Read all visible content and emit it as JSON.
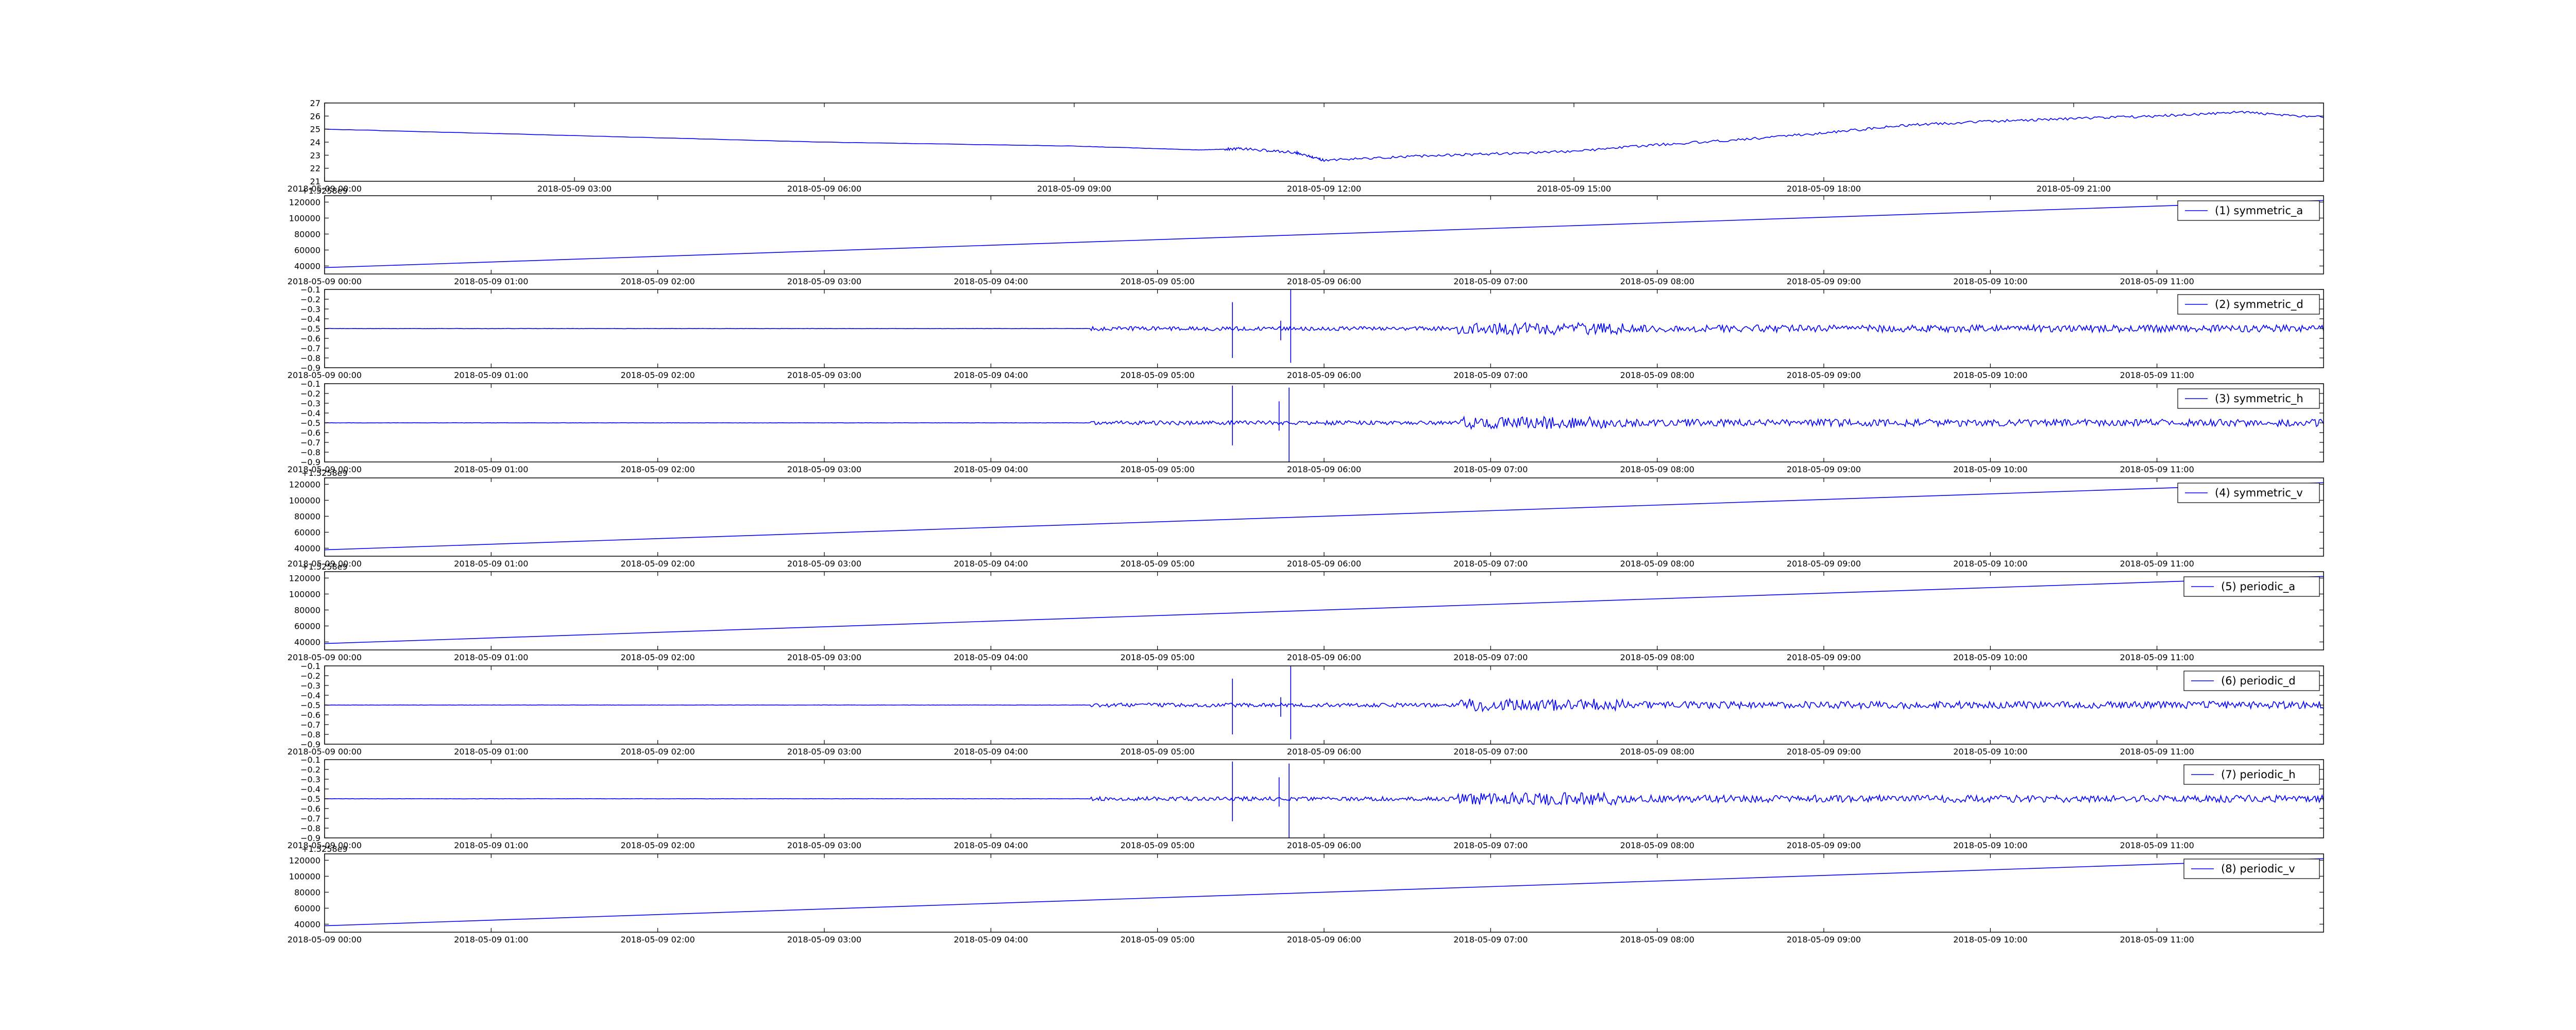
{
  "figure": {
    "background": "#ffffff",
    "line_color": "#0000ff"
  },
  "chart_data": [
    {
      "type": "line",
      "series": [
        {
          "name": "",
          "x": [
            "2018-05-09 00:00",
            "2018-05-09 03:00",
            "2018-05-09 06:00",
            "2018-05-09 09:00",
            "2018-05-09 10:30",
            "2018-05-09 11:00",
            "2018-05-09 11:40",
            "2018-05-09 12:00",
            "2018-05-09 13:00",
            "2018-05-09 14:00",
            "2018-05-09 15:00",
            "2018-05-09 16:00",
            "2018-05-09 17:00",
            "2018-05-09 18:00",
            "2018-05-09 19:00",
            "2018-05-09 20:00",
            "2018-05-09 21:00",
            "2018-05-09 22:00",
            "2018-05-09 23:00",
            "2018-05-09 23:59"
          ],
          "values": [
            25.0,
            24.5,
            24.0,
            23.7,
            23.4,
            23.5,
            23.2,
            22.6,
            22.9,
            23.1,
            23.3,
            23.8,
            24.2,
            24.7,
            25.3,
            25.6,
            25.8,
            26.0,
            26.3,
            25.9
          ]
        }
      ],
      "xticks": [
        "2018-05-09 00:00",
        "2018-05-09 03:00",
        "2018-05-09 06:00",
        "2018-05-09 09:00",
        "2018-05-09 12:00",
        "2018-05-09 15:00",
        "2018-05-09 18:00",
        "2018-05-09 21:00"
      ],
      "yticks": [
        "21",
        "22",
        "23",
        "24",
        "25",
        "26",
        "27"
      ],
      "ylim": [
        21,
        27
      ],
      "offset_text": "",
      "legend": null
    },
    {
      "type": "line",
      "series": [
        {
          "name": "(1) symmetric_a",
          "x": [
            0,
            12
          ],
          "values": [
            38000,
            122000
          ]
        }
      ],
      "xticks": [
        "2018-05-09 00:00",
        "2018-05-09 01:00",
        "2018-05-09 02:00",
        "2018-05-09 03:00",
        "2018-05-09 04:00",
        "2018-05-09 05:00",
        "2018-05-09 06:00",
        "2018-05-09 07:00",
        "2018-05-09 08:00",
        "2018-05-09 09:00",
        "2018-05-09 10:00",
        "2018-05-09 11:00"
      ],
      "yticks": [
        "40000",
        "60000",
        "80000",
        "100000",
        "120000"
      ],
      "ylim": [
        30000,
        128000
      ],
      "offset_text": "+1.5258e9",
      "legend": {
        "label": "(1) symmetric_a",
        "loc": "upper right"
      }
    },
    {
      "type": "line",
      "series": [
        {
          "name": "(2) symmetric_d",
          "baseline": -0.5
        }
      ],
      "xticks": [
        "2018-05-09 00:00",
        "2018-05-09 01:00",
        "2018-05-09 02:00",
        "2018-05-09 03:00",
        "2018-05-09 04:00",
        "2018-05-09 05:00",
        "2018-05-09 06:00",
        "2018-05-09 07:00",
        "2018-05-09 08:00",
        "2018-05-09 09:00",
        "2018-05-09 10:00",
        "2018-05-09 11:00"
      ],
      "yticks": [
        "−0.9",
        "−0.8",
        "−0.7",
        "−0.6",
        "−0.5",
        "−0.4",
        "−0.3",
        "−0.2",
        "−0.1"
      ],
      "ylim": [
        -0.9,
        -0.1
      ],
      "offset_text": "",
      "legend": {
        "label": "(2) symmetric_d",
        "loc": "upper right"
      }
    },
    {
      "type": "line",
      "series": [
        {
          "name": "(3) symmetric_h",
          "baseline": -0.5
        }
      ],
      "xticks": [
        "2018-05-09 00:00",
        "2018-05-09 01:00",
        "2018-05-09 02:00",
        "2018-05-09 03:00",
        "2018-05-09 04:00",
        "2018-05-09 05:00",
        "2018-05-09 06:00",
        "2018-05-09 07:00",
        "2018-05-09 08:00",
        "2018-05-09 09:00",
        "2018-05-09 10:00",
        "2018-05-09 11:00"
      ],
      "yticks": [
        "−0.9",
        "−0.8",
        "−0.7",
        "−0.6",
        "−0.5",
        "−0.4",
        "−0.3",
        "−0.2",
        "−0.1"
      ],
      "ylim": [
        -0.9,
        -0.1
      ],
      "offset_text": "",
      "legend": {
        "label": "(3) symmetric_h",
        "loc": "upper right"
      }
    },
    {
      "type": "line",
      "series": [
        {
          "name": "(4) symmetric_v",
          "x": [
            0,
            12
          ],
          "values": [
            38000,
            122000
          ]
        }
      ],
      "xticks": [
        "2018-05-09 00:00",
        "2018-05-09 01:00",
        "2018-05-09 02:00",
        "2018-05-09 03:00",
        "2018-05-09 04:00",
        "2018-05-09 05:00",
        "2018-05-09 06:00",
        "2018-05-09 07:00",
        "2018-05-09 08:00",
        "2018-05-09 09:00",
        "2018-05-09 10:00",
        "2018-05-09 11:00"
      ],
      "yticks": [
        "40000",
        "60000",
        "80000",
        "100000",
        "120000"
      ],
      "ylim": [
        30000,
        128000
      ],
      "offset_text": "+1.5258e9",
      "legend": {
        "label": "(4) symmetric_v",
        "loc": "upper right"
      }
    },
    {
      "type": "line",
      "series": [
        {
          "name": "(5) periodic_a",
          "x": [
            0,
            12
          ],
          "values": [
            38000,
            122000
          ]
        }
      ],
      "xticks": [
        "2018-05-09 00:00",
        "2018-05-09 01:00",
        "2018-05-09 02:00",
        "2018-05-09 03:00",
        "2018-05-09 04:00",
        "2018-05-09 05:00",
        "2018-05-09 06:00",
        "2018-05-09 07:00",
        "2018-05-09 08:00",
        "2018-05-09 09:00",
        "2018-05-09 10:00",
        "2018-05-09 11:00"
      ],
      "yticks": [
        "40000",
        "60000",
        "80000",
        "100000",
        "120000"
      ],
      "ylim": [
        30000,
        128000
      ],
      "offset_text": "+1.5258e9",
      "legend": {
        "label": "(5) periodic_a",
        "loc": "upper right"
      }
    },
    {
      "type": "line",
      "series": [
        {
          "name": "(6) periodic_d",
          "baseline": -0.5
        }
      ],
      "xticks": [
        "2018-05-09 00:00",
        "2018-05-09 01:00",
        "2018-05-09 02:00",
        "2018-05-09 03:00",
        "2018-05-09 04:00",
        "2018-05-09 05:00",
        "2018-05-09 06:00",
        "2018-05-09 07:00",
        "2018-05-09 08:00",
        "2018-05-09 09:00",
        "2018-05-09 10:00",
        "2018-05-09 11:00"
      ],
      "yticks": [
        "−0.9",
        "−0.8",
        "−0.7",
        "−0.6",
        "−0.5",
        "−0.4",
        "−0.3",
        "−0.2",
        "−0.1"
      ],
      "ylim": [
        -0.9,
        -0.1
      ],
      "offset_text": "",
      "legend": {
        "label": "(6) periodic_d",
        "loc": "upper right"
      }
    },
    {
      "type": "line",
      "series": [
        {
          "name": "(7) periodic_h",
          "baseline": -0.5
        }
      ],
      "xticks": [
        "2018-05-09 00:00",
        "2018-05-09 01:00",
        "2018-05-09 02:00",
        "2018-05-09 03:00",
        "2018-05-09 04:00",
        "2018-05-09 05:00",
        "2018-05-09 06:00",
        "2018-05-09 07:00",
        "2018-05-09 08:00",
        "2018-05-09 09:00",
        "2018-05-09 10:00",
        "2018-05-09 11:00"
      ],
      "yticks": [
        "−0.9",
        "−0.8",
        "−0.7",
        "−0.6",
        "−0.5",
        "−0.4",
        "−0.3",
        "−0.2",
        "−0.1"
      ],
      "ylim": [
        -0.9,
        -0.1
      ],
      "offset_text": "",
      "legend": {
        "label": "(7) periodic_h",
        "loc": "upper right"
      }
    },
    {
      "type": "line",
      "series": [
        {
          "name": "(8) periodic_v",
          "x": [
            0,
            12
          ],
          "values": [
            38000,
            122000
          ]
        }
      ],
      "xticks": [
        "2018-05-09 00:00",
        "2018-05-09 01:00",
        "2018-05-09 02:00",
        "2018-05-09 03:00",
        "2018-05-09 04:00",
        "2018-05-09 05:00",
        "2018-05-09 06:00",
        "2018-05-09 07:00",
        "2018-05-09 08:00",
        "2018-05-09 09:00",
        "2018-05-09 10:00",
        "2018-05-09 11:00"
      ],
      "yticks": [
        "40000",
        "60000",
        "80000",
        "100000",
        "120000"
      ],
      "ylim": [
        30000,
        128000
      ],
      "offset_text": "+1.5258e9",
      "legend": {
        "label": "(8) periodic_v",
        "loc": "upper right"
      }
    }
  ]
}
